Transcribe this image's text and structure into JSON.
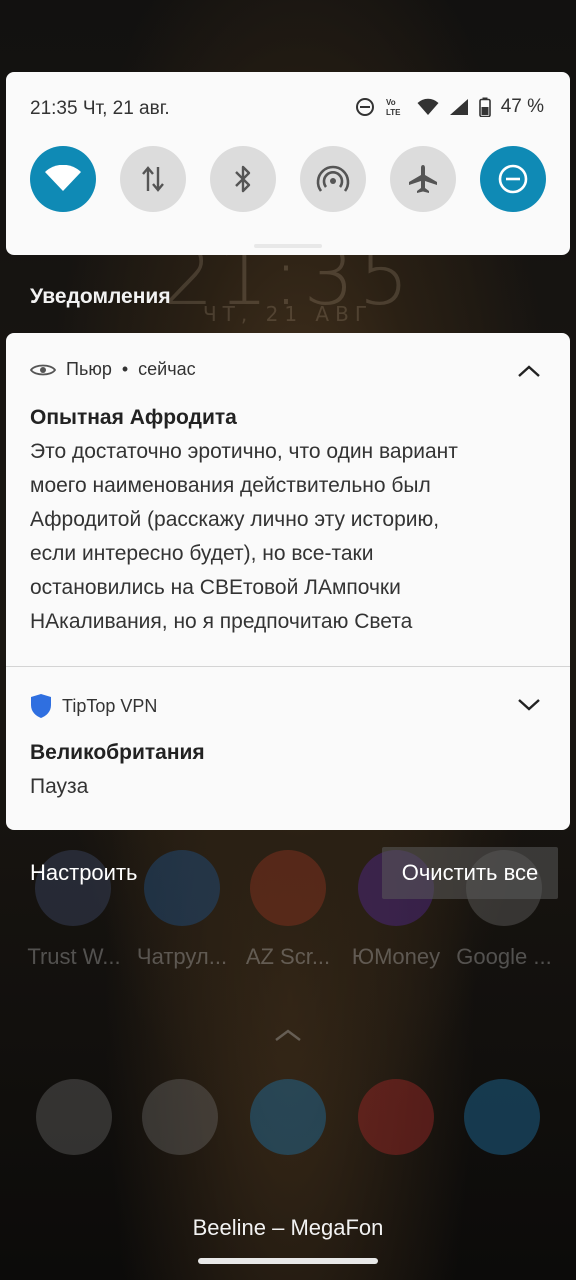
{
  "status": {
    "time_date": "21:35  Чт, 21 авг.",
    "battery": "47 %",
    "network_badge": "Vo LTE",
    "icons": [
      "dnd-icon",
      "volte-icon",
      "wifi-icon",
      "signal-icon",
      "battery-icon"
    ]
  },
  "quick_tiles": [
    {
      "name": "wifi",
      "active": true
    },
    {
      "name": "mobile-data",
      "active": false
    },
    {
      "name": "bluetooth",
      "active": false
    },
    {
      "name": "hotspot",
      "active": false
    },
    {
      "name": "airplane-mode",
      "active": false
    },
    {
      "name": "do-not-disturb",
      "active": true
    }
  ],
  "background": {
    "clock": "21:35",
    "date": "ЧТ, 21 АВГ"
  },
  "notifications_title": "Уведомления",
  "notifications": [
    {
      "app": "Пьюр",
      "separator": "•",
      "time": "сейчас",
      "title": "Опытная Афродита",
      "lines": [
        "Это достаточно эротично, что один вариант",
        "моего наименования действительно был",
        "Афродитой (расскажу лично эту историю,",
        "если интересно будет), но все-таки",
        "остановились на СВЕтовой ЛАмпочки",
        "НАкаливания, но я предпочитаю Света"
      ],
      "expanded": true
    },
    {
      "app": "TipTop VPN",
      "title": "Великобритания",
      "body": "Пауза",
      "expanded": false
    }
  ],
  "actions": {
    "configure": "Настроить",
    "clear_all": "Очистить все"
  },
  "launcher_apps": [
    {
      "label": "Trust W...",
      "color": "#3a5fa8"
    },
    {
      "label": "Чатрул...",
      "color": "#1e6fb0"
    },
    {
      "label": "AZ Scr...",
      "color": "#e04a2a"
    },
    {
      "label": "ЮMoney",
      "color": "#7a3fd0"
    },
    {
      "label": "Google ...",
      "color": "#d8d8d8"
    }
  ],
  "dock_apps": [
    {
      "name": "phone",
      "color": "#d8d8d8"
    },
    {
      "name": "messages",
      "color": "#d8d8d8"
    },
    {
      "name": "telegram",
      "color": "#2aa3df"
    },
    {
      "name": "youtube",
      "color": "#e33"
    },
    {
      "name": "telegram-2",
      "color": "#2aa3df"
    }
  ],
  "carrier": "Beeline – MegaFon"
}
